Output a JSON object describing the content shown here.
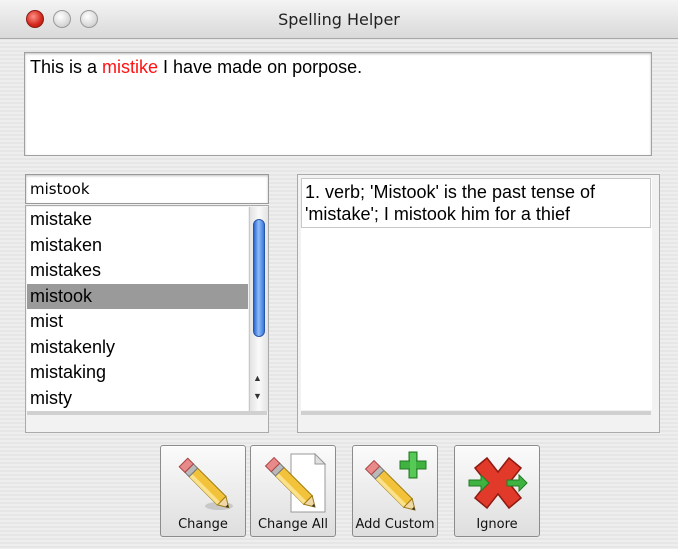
{
  "window": {
    "title": "Spelling Helper"
  },
  "sentence": {
    "before": "This is a ",
    "misspelled": "mistike",
    "after": " I have made on porpose."
  },
  "word_input": {
    "value": "mistook"
  },
  "suggestions": [
    "mistake",
    "mistaken",
    "mistakes",
    "mistook",
    "mist",
    "mistakenly",
    "mistaking",
    "misty"
  ],
  "selected_index": 3,
  "definition": {
    "text": "1. verb; 'Mistook' is the past tense of 'mistake'; I mistook him for a thief"
  },
  "buttons": {
    "change": "Change",
    "change_all": "Change All",
    "add_custom": "Add Custom",
    "ignore": "Ignore"
  },
  "colors": {
    "misspelled": "#ff1111",
    "selection": "#9a9a9a",
    "scroll_thumb": "#3a78e0"
  },
  "icons": [
    "pencil-eraser-icon",
    "pencil-document-icon",
    "pencil-plus-icon",
    "red-x-arrows-icon"
  ]
}
